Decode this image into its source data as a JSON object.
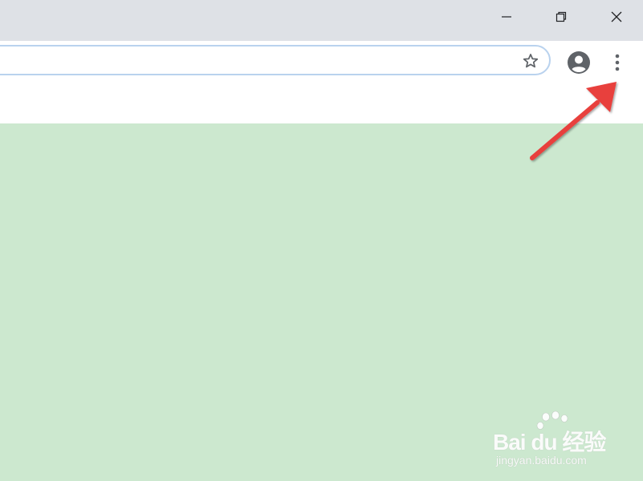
{
  "window": {
    "controls": {
      "minimize": "minimize-icon",
      "restore": "restore-icon",
      "close": "close-icon"
    }
  },
  "toolbar": {
    "omnibox_value": "",
    "bookmark_icon": "star-icon",
    "profile_icon": "account-circle-icon",
    "menu_icon": "more-vertical-icon"
  },
  "annotation": {
    "arrow_color": "#e8413e",
    "points_to": "menu-button"
  },
  "watermark": {
    "brand": "Bai du 经验",
    "url": "jingyan.baidu.com"
  },
  "colors": {
    "titlebar": "#dee1e6",
    "toolbar": "#ffffff",
    "content": "#cce8cf",
    "omnibox_border": "#b9d2ee",
    "icon": "#5f6368"
  }
}
